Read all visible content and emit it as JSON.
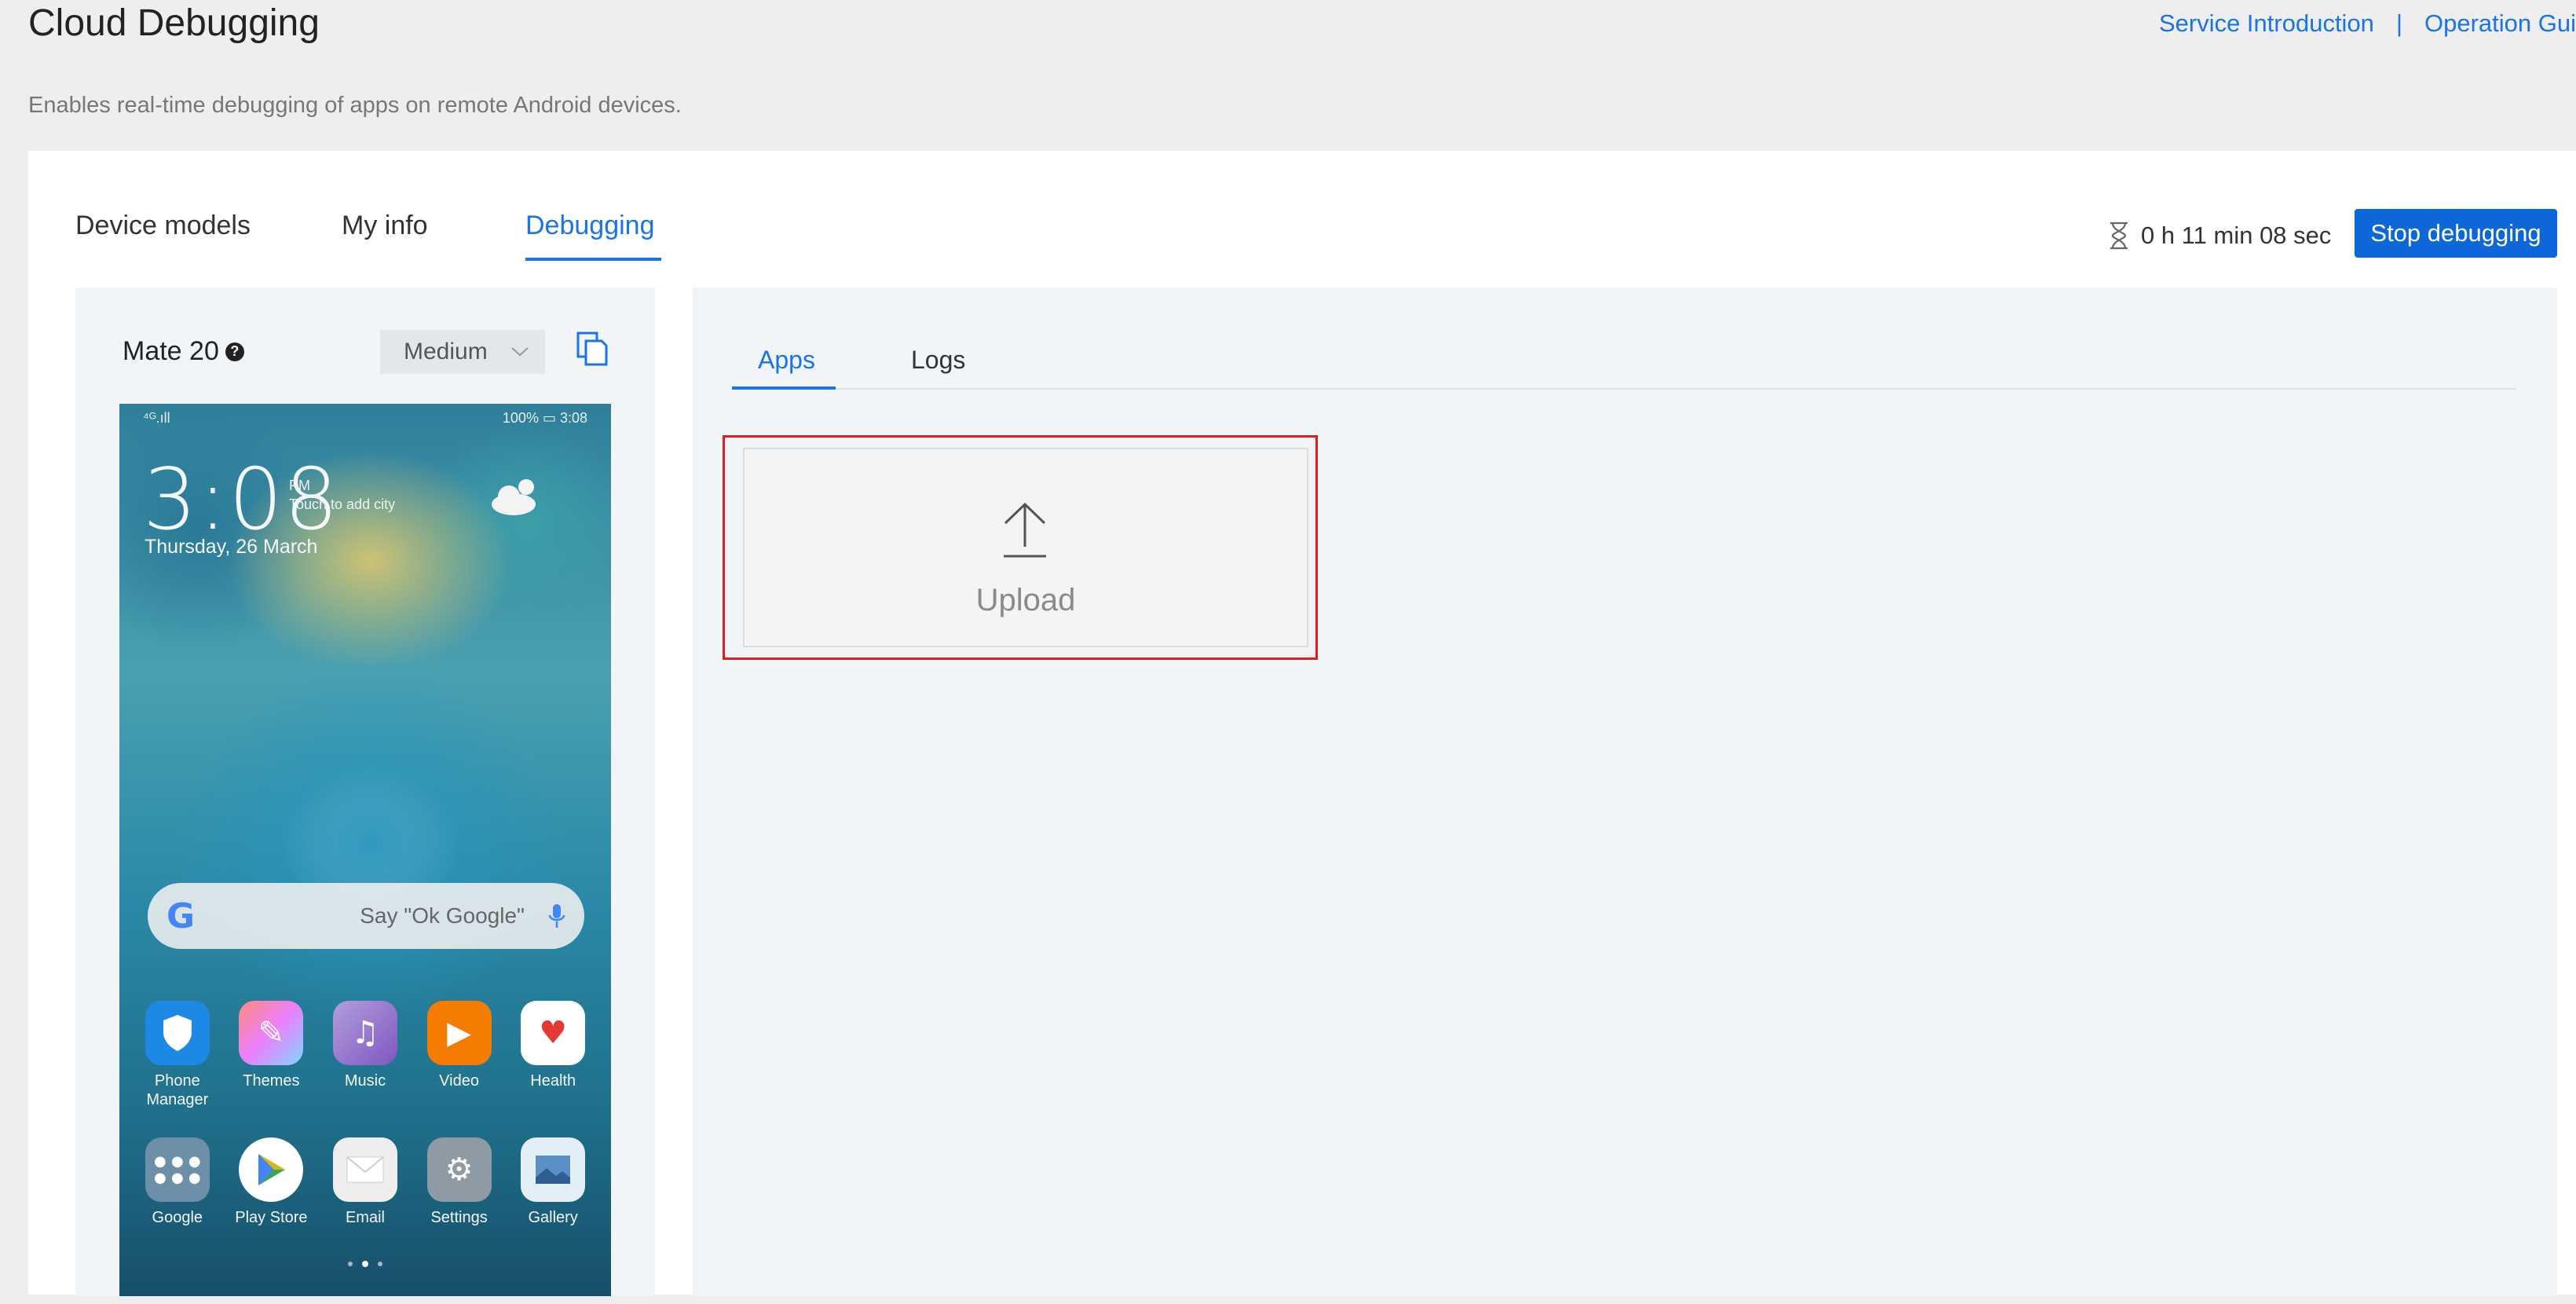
{
  "header": {
    "title": "Cloud Debugging",
    "subtitle": "Enables real-time debugging of apps on remote Android devices.",
    "links": [
      "Service Introduction",
      "Operation Gui"
    ],
    "separator": "|"
  },
  "main_tabs": [
    {
      "label": "Device models",
      "active": false
    },
    {
      "label": "My info",
      "active": false
    },
    {
      "label": "Debugging",
      "active": true
    }
  ],
  "session": {
    "timer": "0 h 11 min 08 sec",
    "stop_label": "Stop debugging"
  },
  "device": {
    "name": "Mate 20",
    "help_icon": "question-circle-icon",
    "quality": "Medium",
    "screenshot_icon": "copy-icon"
  },
  "phone_screen": {
    "status_left": "⁴ᴳ.ıll",
    "status_right": "100% ▭ 3:08",
    "clock": "3:08",
    "ampm": "PM",
    "touch_hint": "Touch to add city",
    "date": "Thursday, 26 March",
    "search_placeholder": "Say \"Ok Google\"",
    "apps_row1": [
      {
        "label": "Phone\nManager",
        "color": "#1e88e5"
      },
      {
        "label": "Themes",
        "color": "#ab47bc"
      },
      {
        "label": "Music",
        "color": "#7e57c2"
      },
      {
        "label": "Video",
        "color": "#f57c00"
      },
      {
        "label": "Health",
        "color": "#ffffff"
      }
    ],
    "apps_row2": [
      {
        "label": "Google",
        "color": "#6d8fa8"
      },
      {
        "label": "Play Store",
        "color": "#ffffff"
      },
      {
        "label": "Email",
        "color": "#eeeeee"
      },
      {
        "label": "Settings",
        "color": "#8e9ba5"
      },
      {
        "label": "Gallery",
        "color": "#e3eef7"
      }
    ]
  },
  "sub_tabs": [
    {
      "label": "Apps",
      "active": true
    },
    {
      "label": "Logs",
      "active": false
    }
  ],
  "upload": {
    "label": "Upload",
    "icon": "upload-arrow-icon"
  },
  "colors": {
    "accent": "#1a73e8",
    "stop_button": "#0e67d9",
    "highlight_border": "#e01e1e"
  }
}
